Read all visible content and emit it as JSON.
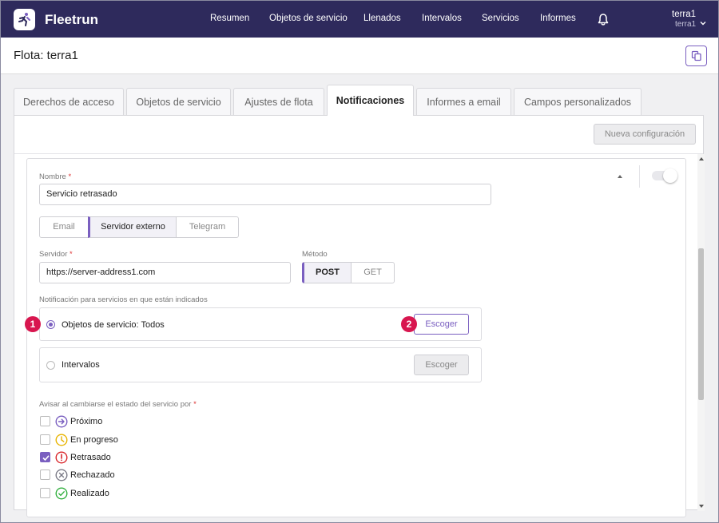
{
  "app": {
    "brand": "Fleetrun"
  },
  "nav": {
    "items": [
      "Resumen",
      "Objetos de servicio",
      "Llenados",
      "Intervalos",
      "Servicios",
      "Informes"
    ],
    "user_name": "terra1",
    "user_sub": "terra1"
  },
  "page": {
    "title": "Flota: terra1"
  },
  "tabs": [
    {
      "label": "Derechos de acceso",
      "active": false
    },
    {
      "label": "Objetos de servicio",
      "active": false
    },
    {
      "label": "Ajustes de flota",
      "active": false
    },
    {
      "label": "Notificaciones",
      "active": true
    },
    {
      "label": "Informes a email",
      "active": false
    },
    {
      "label": "Campos personalizados",
      "active": false
    }
  ],
  "toolbar": {
    "new_config_label": "Nueva configuración"
  },
  "form": {
    "name_label": "Nombre",
    "required_mark": "*",
    "name_value": "Servicio retrasado",
    "channels": [
      "Email",
      "Servidor externo",
      "Telegram"
    ],
    "channel_selected": "Servidor externo",
    "server_label": "Servidor",
    "server_value": "https://server-address1.com",
    "method_label": "Método",
    "methods": [
      "POST",
      "GET"
    ],
    "method_selected": "POST",
    "notify_label": "Notificación para servicios en que están indicados",
    "option_objects": "Objetos de servicio: Todos",
    "option_intervals": "Intervalos",
    "choose_label": "Escoger",
    "status_label": "Avisar al cambiarse el estado del servicio por",
    "statuses": [
      {
        "label": "Próximo",
        "checked": false,
        "icon": "arrow-right-circle-icon",
        "color": "#7a5fc0"
      },
      {
        "label": "En progreso",
        "checked": false,
        "icon": "clock-icon",
        "color": "#e8b400"
      },
      {
        "label": "Retrasado",
        "checked": true,
        "icon": "exclamation-circle-icon",
        "color": "#d9262b"
      },
      {
        "label": "Rechazado",
        "checked": false,
        "icon": "x-circle-icon",
        "color": "#7a7a86"
      },
      {
        "label": "Realizado",
        "checked": false,
        "icon": "check-circle-icon",
        "color": "#33b040"
      }
    ]
  },
  "callouts": [
    "1",
    "2"
  ],
  "colors": {
    "nav_bg": "#2e2a5c",
    "accent": "#7a5fc0",
    "badge": "#d8164f"
  }
}
